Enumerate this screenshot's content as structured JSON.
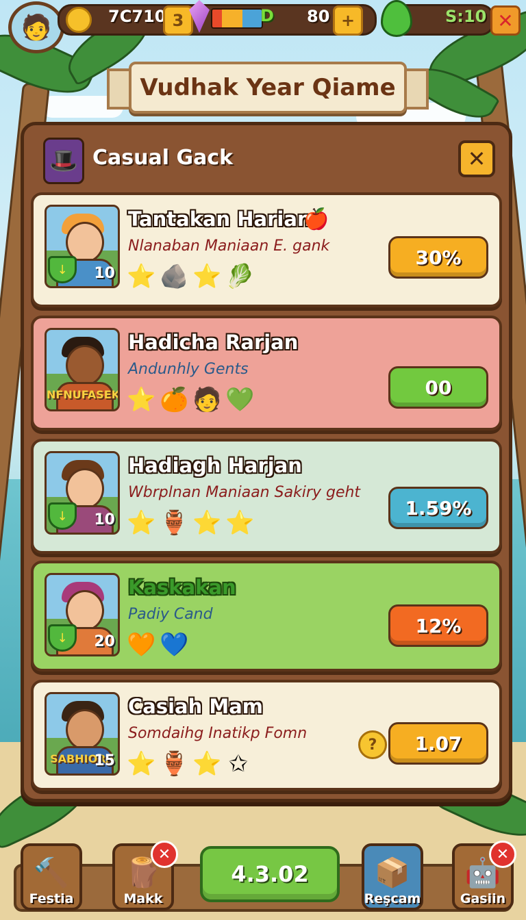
{
  "topbar": {
    "coins": "7C710",
    "coins_badge": "3",
    "energy_letter": "D",
    "energy_value": "80",
    "plus_label": "+",
    "timer": "S:10",
    "close_label": "✕"
  },
  "banner": {
    "title": "Vudhak Year Qiame"
  },
  "panel": {
    "title": "Casual Gack",
    "close_label": "✕"
  },
  "cards": [
    {
      "title": "Tantakan Harian",
      "subtitle": "Nlanaban Maniaan E. gank",
      "level": "10",
      "value": "30%",
      "bg": "#f7efd9",
      "pill": "#f6ae22",
      "subcolor": "#8b1d1d"
    },
    {
      "title": "Hadicha Rarjan",
      "subtitle": "Andunhly Gents",
      "sign": "NFNUFASEK",
      "value": "00",
      "bg": "#eea298",
      "pill": "#72c93f",
      "subcolor": "#2a5a8a"
    },
    {
      "title": "Hadiagh Harjan",
      "subtitle": "Wbrplnan Maniaan Sakiry geht",
      "level": "10",
      "value": "1.59%",
      "bg": "#d5e8d6",
      "pill": "#4cb4d0",
      "subcolor": "#8b1d1d"
    },
    {
      "title": "Kaskakan",
      "subtitle": "Padiy Cand",
      "level": "20",
      "value": "12%",
      "bg": "#9ad363",
      "pill": "#f26a22",
      "subcolor": "#2a5a8a"
    },
    {
      "title": "Casiah Mam",
      "subtitle": "Somdaihg Inatikp Fomn",
      "level": "15",
      "sign": "SABHIORA",
      "hint": "?",
      "value": "1.07",
      "bg": "#f7efd9",
      "pill": "#f6ae22",
      "subcolor": "#8b1d1d"
    }
  ],
  "bottom": {
    "festia": "Festia",
    "makk": "Makk",
    "center_value": "4.3.02",
    "rescam": "Reşcam",
    "gasiin": "Gasiin",
    "x_label": "✕"
  }
}
